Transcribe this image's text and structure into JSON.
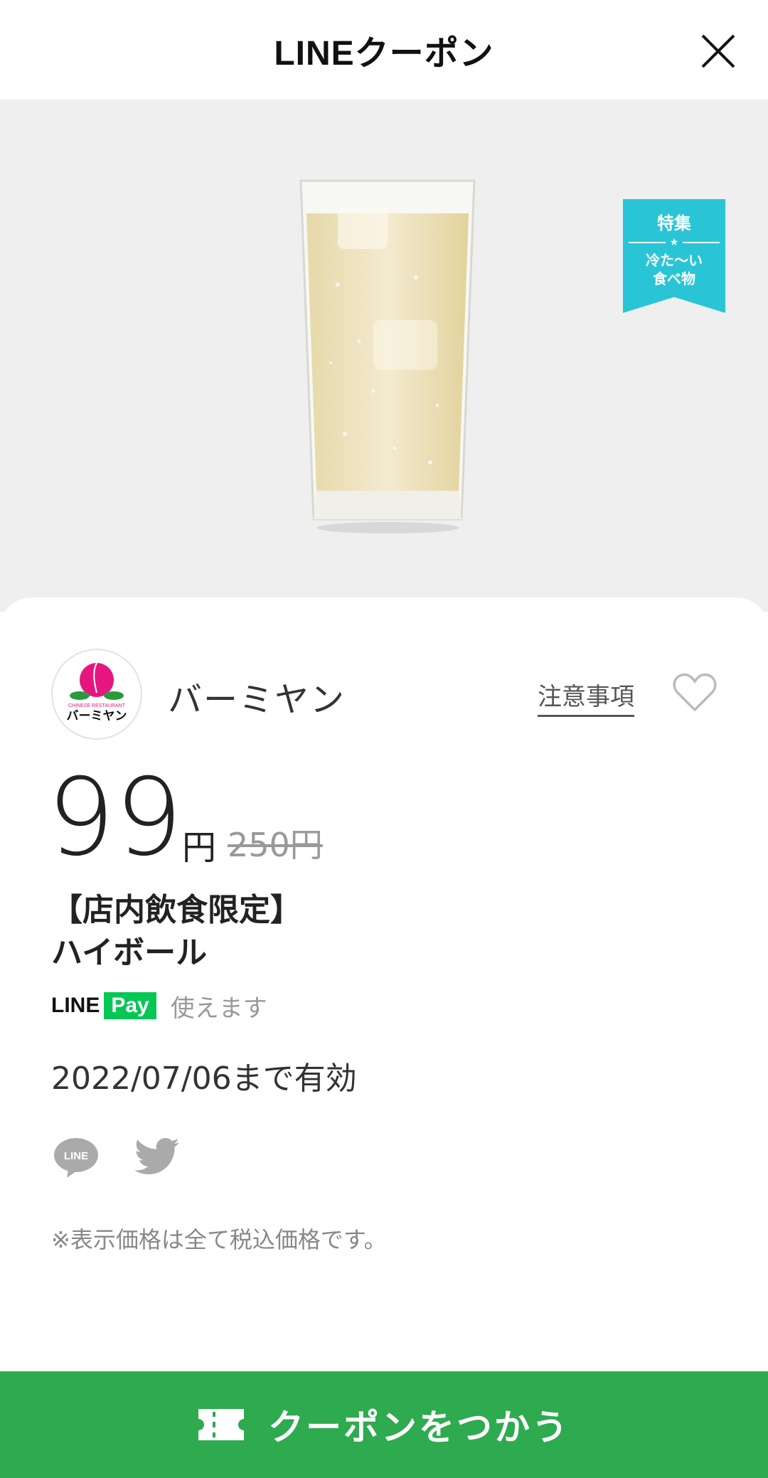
{
  "header": {
    "title": "LINEクーポン",
    "close_icon": "close-icon"
  },
  "hero": {
    "ribbon_title": "特集",
    "ribbon_star": "★",
    "ribbon_line1": "冷た〜い",
    "ribbon_line2": "食べ物",
    "ribbon_color": "#29c5d6"
  },
  "store": {
    "name": "バーミヤン",
    "logo_text_small": "CHINESE RESTAURANT",
    "logo_text": "バーミヤン",
    "notes_label": "注意事項",
    "favorite_icon": "heart-icon"
  },
  "offer": {
    "price": "99",
    "currency": "円",
    "original_price": "250円",
    "title_line1": "【店内飲食限定】",
    "title_line2": "ハイボール",
    "linepay_brand": "LINE",
    "linepay_badge": "Pay",
    "linepay_note": "使えます",
    "valid_until": "2022/07/06まで有効",
    "tax_note": "※表示価格は全て税込価格です。"
  },
  "share": {
    "line_icon": "line-share-icon",
    "twitter_icon": "twitter-share-icon",
    "line_icon_text": "LINE"
  },
  "cta": {
    "label": "クーポンをつかう",
    "icon": "ticket-icon",
    "color": "#2eaa4f"
  }
}
